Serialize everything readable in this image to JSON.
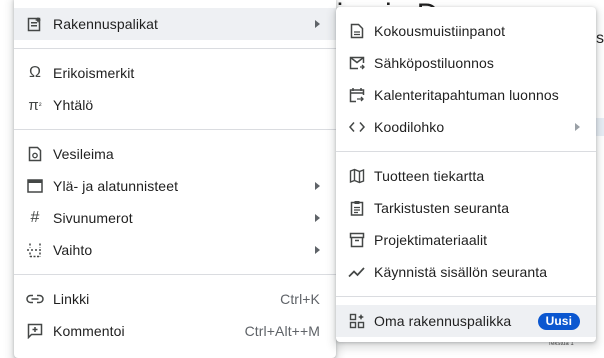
{
  "background": {
    "title_fragment": "lallina ja Docs",
    "side_letter": "s",
    "tiny_text": "Tekstua 1"
  },
  "left_menu": {
    "items": [
      {
        "label": "Rakennuspalikat",
        "icon": "building-blocks-icon",
        "submenu": true
      },
      {
        "label": "Erikoismerkit",
        "icon": "omega-icon"
      },
      {
        "label": "Yhtälö",
        "icon": "pi-squared-icon"
      },
      {
        "label": "Vesileima",
        "icon": "watermark-icon"
      },
      {
        "label": "Ylä- ja alatunnisteet",
        "icon": "header-footer-icon",
        "submenu": true
      },
      {
        "label": "Sivunumerot",
        "icon": "hash-icon",
        "submenu": true
      },
      {
        "label": "Vaihto",
        "icon": "break-icon",
        "submenu": true
      },
      {
        "label": "Linkki",
        "icon": "link-icon",
        "shortcut": "Ctrl+K"
      },
      {
        "label": "Kommentoi",
        "icon": "add-comment-icon",
        "shortcut": "Ctrl+Alt++M"
      }
    ]
  },
  "right_menu": {
    "items": [
      {
        "label": "Kokousmuistiinpanot",
        "icon": "document-icon"
      },
      {
        "label": "Sähköpostiluonnos",
        "icon": "email-draft-icon"
      },
      {
        "label": "Kalenteritapahtuman luonnos",
        "icon": "calendar-event-icon"
      },
      {
        "label": "Koodilohko",
        "icon": "code-icon",
        "submenu": true
      },
      {
        "label": "Tuotteen tiekartta",
        "icon": "map-icon"
      },
      {
        "label": "Tarkistusten seuranta",
        "icon": "checklist-icon"
      },
      {
        "label": "Projektimateriaalit",
        "icon": "archive-icon"
      },
      {
        "label": "Käynnistä sisällön seuranta",
        "icon": "trend-icon"
      },
      {
        "label": "Oma rakennuspalikka",
        "icon": "custom-block-icon",
        "badge": "Uusi"
      }
    ]
  },
  "colors": {
    "badge": "#0b57d0",
    "hover": "#eef0f3",
    "separator": "#dadce0"
  }
}
